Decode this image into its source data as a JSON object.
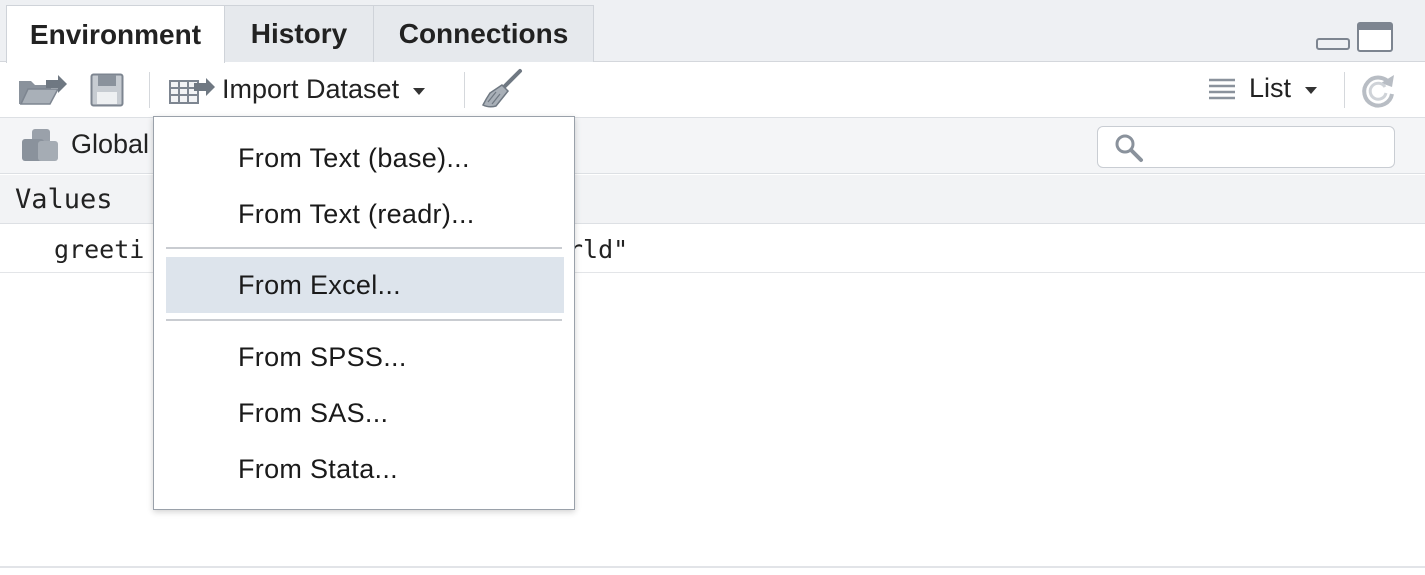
{
  "tabs": [
    {
      "label": "Environment",
      "active": true
    },
    {
      "label": "History",
      "active": false
    },
    {
      "label": "Connections",
      "active": false
    }
  ],
  "toolbar": {
    "open_icon": "folder-open-arrow-icon",
    "save_icon": "floppy-disk-icon",
    "import_icon": "table-arrow-icon",
    "import_label": "Import Dataset",
    "broom_icon": "broom-icon",
    "view_label": "List",
    "refresh_icon": "refresh-icon"
  },
  "environment": {
    "selector_label": "Global",
    "selector_icon": "stack-cubes-icon",
    "search_placeholder": "",
    "search_icon": "search-icon"
  },
  "values": {
    "header": "Values",
    "rows": [
      {
        "name": "greeti",
        "value": "rld\""
      }
    ]
  },
  "import_menu": {
    "items": [
      {
        "label": "From Text (base)...",
        "highlighted": false
      },
      {
        "label": "From Text (readr)...",
        "highlighted": false
      },
      {
        "label": "From Excel...",
        "highlighted": true
      },
      {
        "label": "From SPSS...",
        "highlighted": false
      },
      {
        "label": "From SAS...",
        "highlighted": false
      },
      {
        "label": "From Stata...",
        "highlighted": false
      }
    ]
  },
  "colors": {
    "tab_bg": "#e6e9ed",
    "menu_highlight": "#dde4ec",
    "menu_border": "#9aa1aa",
    "icon_gray": "#7d8590"
  }
}
